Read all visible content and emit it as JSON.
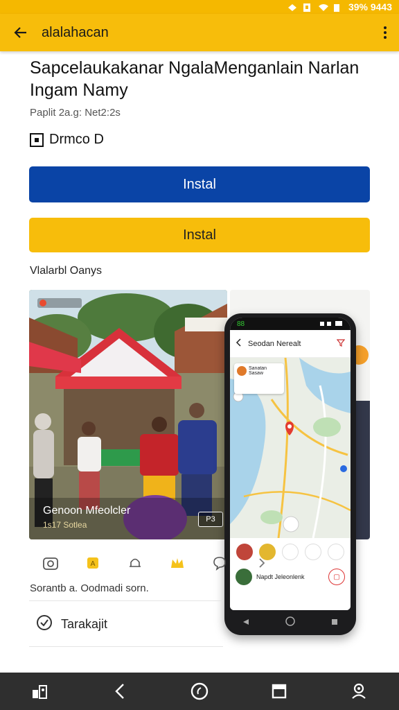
{
  "status_bar": {
    "text": "39% 9443"
  },
  "app_bar": {
    "title": "alalahacan"
  },
  "app": {
    "title": "Sapcelaukakanar NgalaMenganlain Narlan Ingam Namy",
    "meta": "Paplit 2a.g: Net2:2s",
    "rating_label": "Drmco D"
  },
  "buttons": {
    "primary_label": "Instal",
    "secondary_label": "Instal"
  },
  "screenshots": {
    "section_label": "Vlalarbl Oanys",
    "caption_title": "Genoon Mfeolcler",
    "caption_sub": "1s17 Sotlea",
    "play_badge": "P3",
    "phone": {
      "status": "88",
      "header_title": "Seodan Nerealt",
      "card_text": "Sanatan Sasaw",
      "place_name": "Napdt Jeleonlenk"
    }
  },
  "icon_row": [
    "camera-icon",
    "badge-icon",
    "bell-icon",
    "crown-icon",
    "chat-icon"
  ],
  "description": "Sorantb a. Oodmadi sorn.",
  "feature": {
    "label": "Tarakajit"
  },
  "colors": {
    "accent_yellow": "#f7bd0b",
    "primary_blue": "#0a44a6",
    "nav_dark": "#2f2f2f"
  }
}
